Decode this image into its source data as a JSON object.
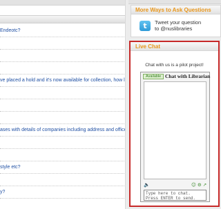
{
  "faq": {
    "items": [
      {
        "text": "Endeotc?"
      },
      {
        "text": ""
      },
      {
        "text": ""
      },
      {
        "text": ""
      },
      {
        "text": "ve placed a hold and it's now available for collection, how long"
      },
      {
        "text": ""
      },
      {
        "text": ""
      },
      {
        "text": ""
      },
      {
        "text": "ases with details of companies including address and office"
      },
      {
        "text": ""
      },
      {
        "text": ""
      },
      {
        "text": "style etc?"
      },
      {
        "text": ""
      },
      {
        "text": "y?"
      },
      {
        "text": ""
      }
    ]
  },
  "more_ways": {
    "title": "More Ways to Ask Questions",
    "twitter_glyph": "t",
    "tweet_line1": "Tweet your question",
    "tweet_line2": "to @nuslibraries"
  },
  "live_chat": {
    "title": "Live Chat",
    "intro": "Chat with us is a pilot project!",
    "widget": {
      "status": "Available",
      "title": "Chat with Librarian",
      "input_placeholder": "Type here to chat. Press ENTER to send."
    }
  },
  "colors": {
    "accent_orange": "#e8961b",
    "highlight_red": "#c62828",
    "link_blue": "#1f4fa3",
    "status_green": "#2d7a1a"
  },
  "icons": {
    "twitter": "twitter-icon",
    "sound": "sound-icon",
    "chat_tools": "chat-tools-icon"
  }
}
